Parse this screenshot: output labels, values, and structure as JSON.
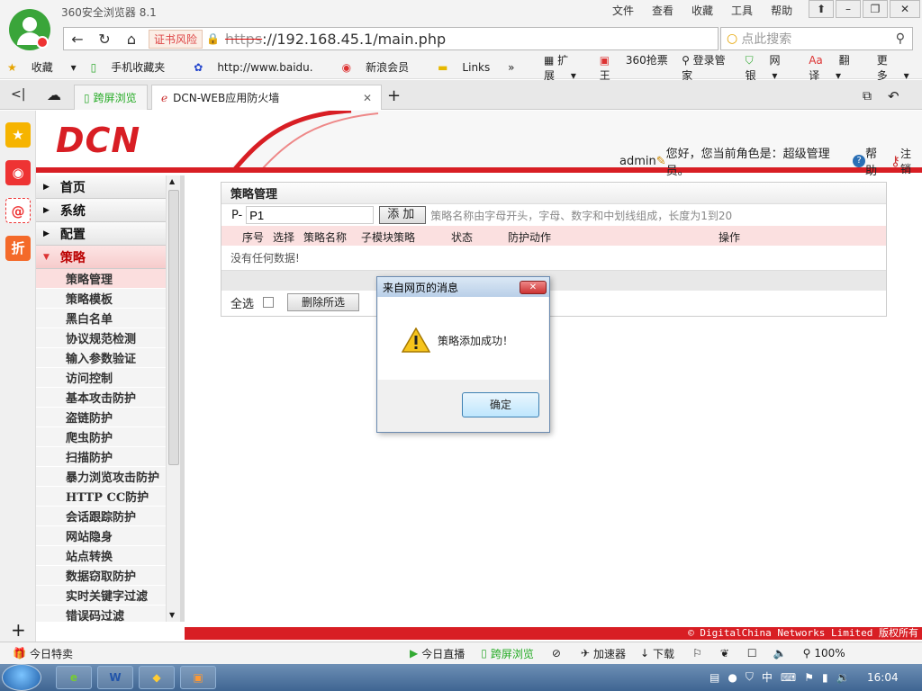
{
  "browser": {
    "title": "360安全浏览器 8.1",
    "menu": [
      "文件",
      "查看",
      "收藏",
      "工具",
      "帮助"
    ],
    "cert_warning": "证书风险",
    "url_scheme": "https",
    "url_rest": "://192.168.45.1/main.php",
    "search_placeholder": "点此搜索",
    "bookmarks": [
      "收藏",
      "手机收藏夹",
      "http://www.baidu.",
      "新浪会员",
      "Links"
    ],
    "toolbar_right": [
      "扩展",
      "360抢票王",
      "登录管家",
      "网银",
      "翻译",
      "更多"
    ],
    "tabs": [
      {
        "label": "跨屏浏览"
      },
      {
        "label": "DCN-WEB应用防火墙"
      }
    ]
  },
  "header": {
    "logo_text": "DCN",
    "user": "admin",
    "greeting": "您好，您当前角色是：超级管理员。",
    "help": "帮助",
    "logout": "注销"
  },
  "nav": {
    "headers": [
      "首页",
      "系统",
      "配置",
      "策略"
    ],
    "items": [
      "策略管理",
      "策略模板",
      "黑白名单",
      "协议规范检测",
      "输入参数验证",
      "访问控制",
      "基本攻击防护",
      "盗链防护",
      "爬虫防护",
      "扫描防护",
      "暴力浏览攻击防护",
      "HTTP CC防护",
      "会话跟踪防护",
      "网站隐身",
      "站点转换",
      "数据窃取防护",
      "实时关键字过滤",
      "错误码过滤"
    ]
  },
  "panel": {
    "title": "策略管理",
    "prefix": "P-",
    "input_value": "P1",
    "add_button": "添加",
    "hint": "策略名称由字母开头，字母、数字和中划线组成，长度为1到20",
    "columns": [
      "序号",
      "选择",
      "策略名称",
      "子模块策略",
      "状态",
      "防护动作",
      "操作"
    ],
    "empty": "没有任何数据!",
    "select_all": "全选",
    "delete_button": "删除所选"
  },
  "footer": {
    "copyright": "© DigitalChina Networks Limited 版权所有"
  },
  "statusbar": {
    "left": "今日特卖",
    "items": [
      "今日直播",
      "跨屏浏览",
      "加速器",
      "下载"
    ],
    "zoom": "100%"
  },
  "taskbar": {
    "clock": "16:04"
  },
  "dialog": {
    "title": "来自网页的消息",
    "message": "策略添加成功！",
    "ok": "确定"
  }
}
